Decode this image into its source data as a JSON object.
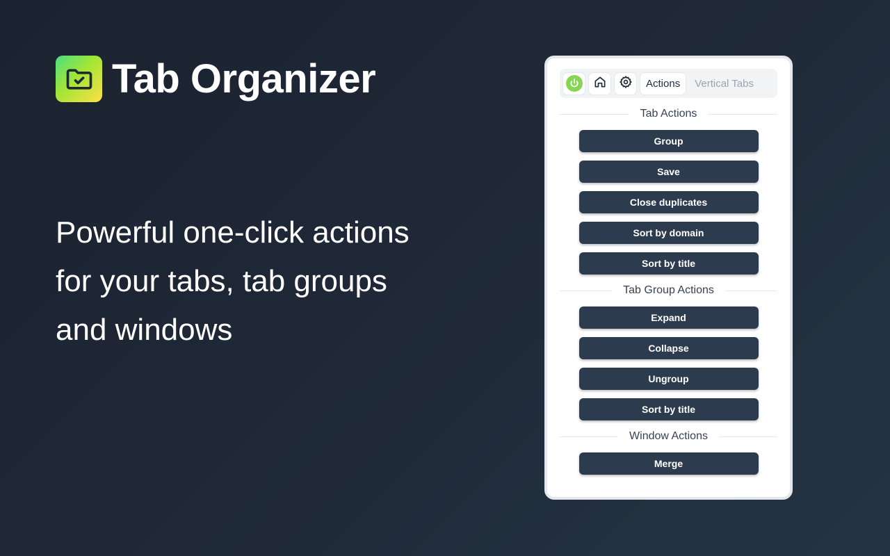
{
  "brand": {
    "name": "Tab Organizer",
    "logo_icon": "folder-check-icon"
  },
  "tagline": {
    "line1": "Powerful one-click actions",
    "line2": "for your tabs, tab groups",
    "line3": "and windows"
  },
  "popup": {
    "toolbar": {
      "power_icon": "power-icon",
      "home_icon": "home-icon",
      "settings_icon": "gear-icon",
      "tabs": [
        "Actions",
        "Vertical Tabs"
      ],
      "active_tab": "Actions"
    },
    "sections": [
      {
        "title": "Tab Actions",
        "buttons": [
          "Group",
          "Save",
          "Close duplicates",
          "Sort by domain",
          "Sort by title"
        ]
      },
      {
        "title": "Tab Group Actions",
        "buttons": [
          "Expand",
          "Collapse",
          "Ungroup",
          "Sort by title"
        ]
      },
      {
        "title": "Window Actions",
        "buttons": [
          "Merge"
        ]
      }
    ]
  },
  "colors": {
    "background": "#1f2937",
    "button": "#2d3b4f",
    "power_on": "#86d553",
    "logo_gradient": [
      "#4ade80",
      "#a3e635",
      "#fde047"
    ]
  }
}
